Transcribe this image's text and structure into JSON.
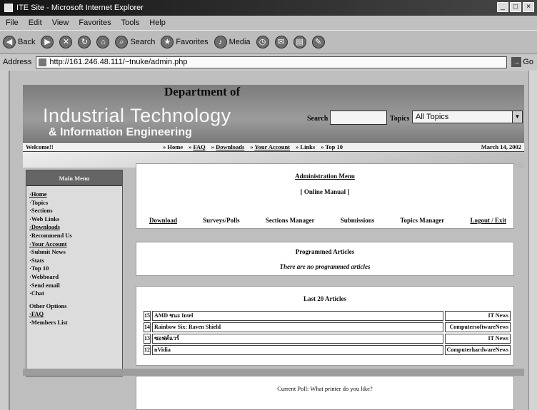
{
  "window": {
    "title": "ITE Site - Microsoft Internet Explorer",
    "buttons": [
      "_",
      "□",
      "×"
    ]
  },
  "menu": [
    "File",
    "Edit",
    "View",
    "Favorites",
    "Tools",
    "Help"
  ],
  "toolbar": {
    "back": "Back",
    "search": "Search",
    "favorites": "Favorites",
    "media": "Media"
  },
  "address": {
    "label": "Address",
    "url": "http://161.246.48.111/~tnuke/admin.php",
    "go": "Go"
  },
  "site": {
    "dept": "Department of",
    "logo_line1": "Industrial Technology",
    "logo_line2": "& Information Engineering",
    "search_label": "Search",
    "topics_label": "Topics",
    "topics_value": "All Topics"
  },
  "nav": {
    "welcome": "Welcome!!",
    "links": [
      "Home",
      "FAQ",
      "Downloads",
      "Your Account",
      "Links",
      "Top 10"
    ],
    "date": "March 14, 2002"
  },
  "mainmenu": {
    "title": "Main Menu",
    "items": [
      "Home",
      "Topics",
      "Sections",
      "Web Links",
      "Downloads",
      "Recommend Us",
      "Your Account",
      "Submit News",
      "Stats",
      "Top 10",
      "Webboard",
      "Send email",
      "Chat"
    ],
    "other_title": "Other Options",
    "other_items": [
      "FAQ",
      "Members List"
    ]
  },
  "admin": {
    "title": "Administration Menu",
    "manual": "[ Online Manual ]",
    "links": [
      "Download",
      "Surveys/Polls",
      "Sections Manager",
      "Submissions",
      "Topics Manager",
      "Logout / Exit"
    ]
  },
  "programmed": {
    "title": "Programmed Articles",
    "empty": "There are no programmed articles"
  },
  "last": {
    "title": "Last 20 Articles",
    "articles": [
      {
        "num": "15",
        "title": "AMD ชนะ Intel",
        "category": "IT News"
      },
      {
        "num": "14",
        "title": "Rainbow Six: Raven Shield",
        "category": "ComputersoftwareNews"
      },
      {
        "num": "13",
        "title": "ซอฟต์แวร์",
        "category": "IT News"
      },
      {
        "num": "12",
        "title": "nVidia",
        "category": "ComputerhardwareNews"
      }
    ]
  },
  "poll": {
    "text": "Current Poll: What printer do you like?"
  }
}
